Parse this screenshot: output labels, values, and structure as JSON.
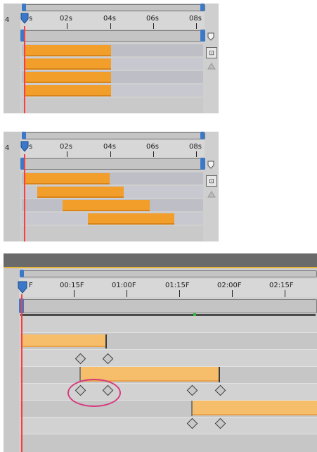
{
  "panel1": {
    "labels": [
      "s",
      "02s",
      "04s",
      "06s",
      "08s"
    ],
    "left_glyph": "4"
  },
  "panel2": {
    "labels": [
      "s",
      "02s",
      "04s",
      "06s",
      "08s"
    ],
    "left_glyph": "4"
  },
  "panel3": {
    "labels": [
      "F",
      "00:15F",
      "01:00F",
      "01:15F",
      "02:00F",
      "02:15F"
    ]
  },
  "colors": {
    "layer_bar": "#f29e2b",
    "layer_bar_light": "#f6bd6a",
    "playhead": "#ff3b3b",
    "highlight": "#d63a7d",
    "cti_blue": "#3c78c8"
  },
  "icons": {
    "panel1_side_icons": [
      "marker-icon",
      "comp-icon",
      "lock-icon"
    ],
    "panel2_side_icons": [
      "marker-icon",
      "comp-icon",
      "lock-icon"
    ]
  }
}
